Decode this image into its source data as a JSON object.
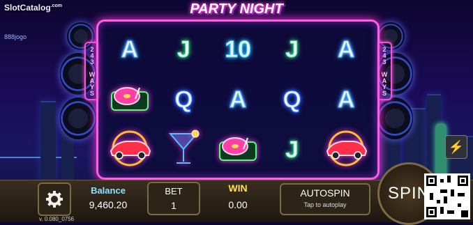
{
  "brand": {
    "site": "SlotCatalog",
    "site_suffix": ".com",
    "sub": "888jogo"
  },
  "game": {
    "title": "PARTY NIGHT",
    "ways_label": "243 WAYS"
  },
  "reels": [
    [
      "A",
      "J",
      "10",
      "J",
      "A"
    ],
    [
      "turntable",
      "Q",
      "A",
      "Q",
      "A"
    ],
    [
      "car",
      "cocktail",
      "turntable",
      "J",
      "car"
    ]
  ],
  "controls": {
    "settings_icon": "gear-icon",
    "balance_label": "Balance",
    "balance_value": "9,460.20",
    "bet_label": "BET",
    "bet_value": "1",
    "win_label": "WIN",
    "win_value": "0.00",
    "autospin_label": "AUTOSPIN",
    "autospin_sub": "Tap to autoplay",
    "spin_label": "SPIN",
    "side_icon": "lightning-icon"
  },
  "version": "v. 0.080_0756",
  "colors": {
    "frame": "#ff5ee1",
    "balance_label": "#8de0ff",
    "win_label": "#ffe04a"
  }
}
